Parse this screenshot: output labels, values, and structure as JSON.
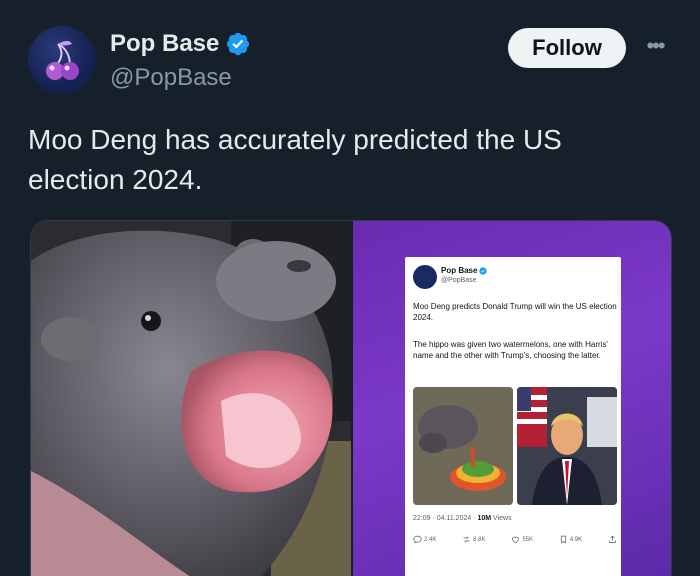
{
  "author": {
    "display_name": "Pop Base",
    "handle": "@PopBase",
    "verified_icon": "verified-badge-icon"
  },
  "actions": {
    "follow_label": "Follow",
    "more_label": "•••"
  },
  "tweet": {
    "text": "Moo Deng has accurately predicted the US election 2024."
  },
  "embedded_post": {
    "display_name": "Pop Base",
    "handle": "@PopBase",
    "text_1": "Moo Deng predicts Donald Trump will win the US election 2024.",
    "text_2": "The hippo was given two watermelons, one with Harris' name and the other with Trump's, choosing the latter.",
    "time": "22:09 · 04.11.2024 · ",
    "views_value": "10M",
    "views_label": " Views",
    "stats": {
      "replies": "2.4K",
      "reposts": "8.8K",
      "likes": "55K",
      "bookmarks": "4.9K"
    }
  },
  "colors": {
    "background": "#15202b",
    "text": "#e7e9ea",
    "secondary": "#8b98a5",
    "verified": "#1d9bf0",
    "media_gradient": "#6a2bb0"
  }
}
